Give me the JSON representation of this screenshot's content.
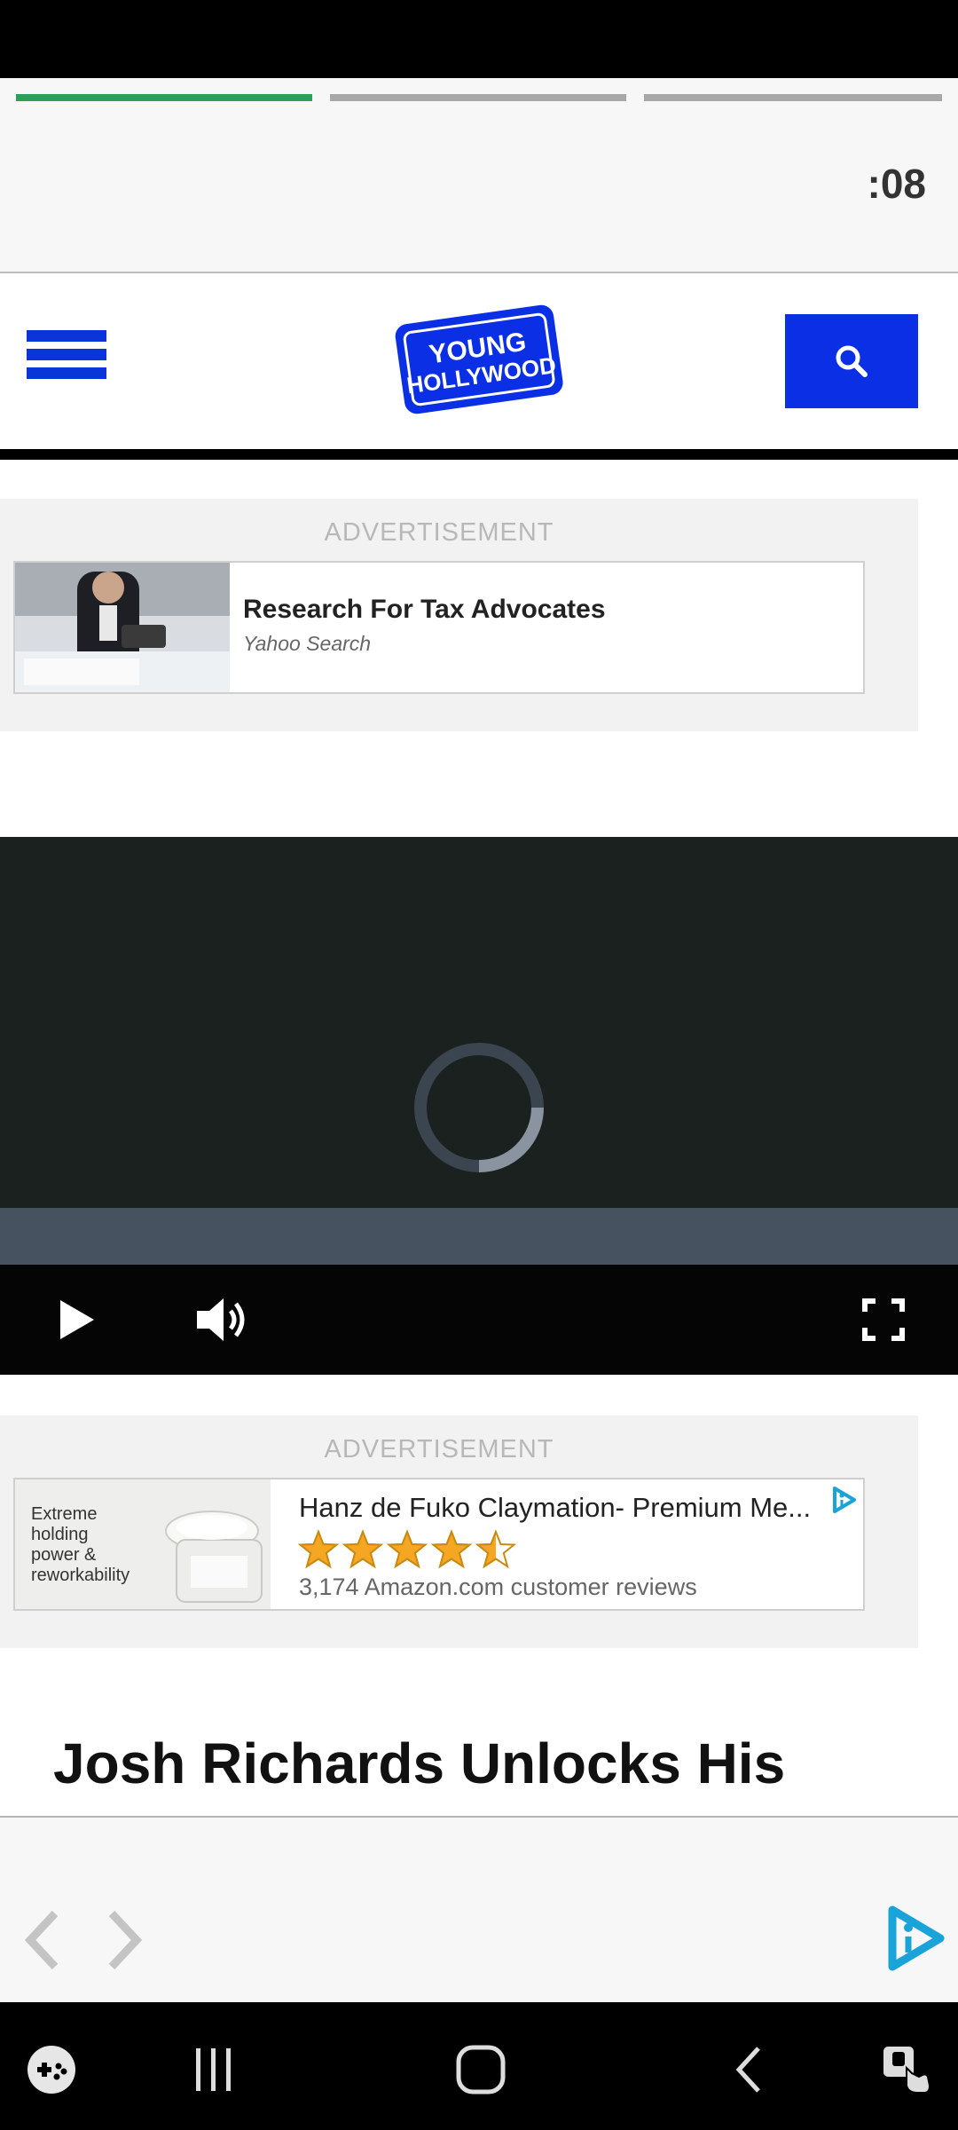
{
  "story": {
    "timer": ":08",
    "progress": [
      1.0,
      0.0,
      0.0
    ]
  },
  "header": {
    "logo_line1": "YOUNG",
    "logo_line2": "HOLLYWOOD"
  },
  "ad1": {
    "label": "ADVERTISEMENT",
    "title": "Research For Tax Advocates",
    "source": "Yahoo Search"
  },
  "video": {
    "state": "loading"
  },
  "ad2": {
    "label": "ADVERTISEMENT",
    "title": "Hanz de Fuko Claymation- Premium Me...",
    "tagline": "Extreme holding power & reworkability",
    "rating": 4.5,
    "reviews": "3,174 Amazon.com customer reviews"
  },
  "article": {
    "headline": "Josh Richards Unlocks His"
  },
  "colors": {
    "brand_blue": "#0a2fe4",
    "progress_green": "#2e9e58",
    "star_gold": "#f5a623"
  },
  "icons": [
    "hamburger-icon",
    "search-icon",
    "play-icon",
    "volume-icon",
    "fullscreen-icon",
    "back-arrow-icon",
    "forward-arrow-icon",
    "ad-play-icon"
  ]
}
